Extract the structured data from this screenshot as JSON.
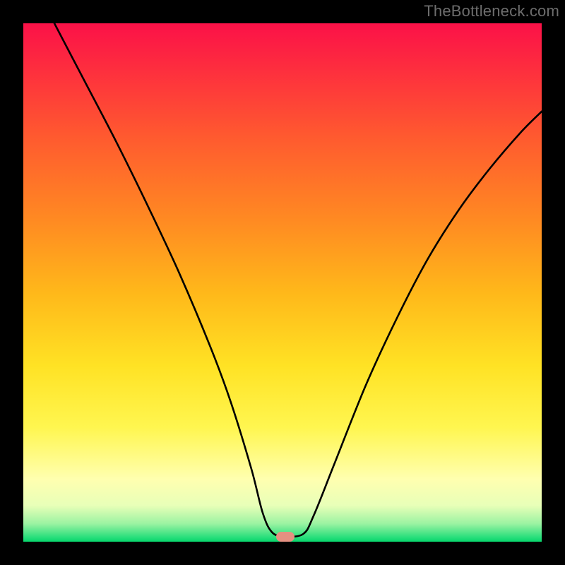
{
  "watermark": "TheBottleneck.com",
  "marker": {
    "x_frac": 0.505,
    "y_frac": 0.99
  },
  "chart_data": {
    "type": "line",
    "title": "",
    "xlabel": "",
    "ylabel": "",
    "xlim": [
      0,
      1
    ],
    "ylim": [
      0,
      1
    ],
    "series": [
      {
        "name": "bottleneck-curve",
        "x": [
          0.06,
          0.12,
          0.18,
          0.24,
          0.3,
          0.36,
          0.4,
          0.44,
          0.462,
          0.48,
          0.505,
          0.54,
          0.56,
          0.6,
          0.66,
          0.72,
          0.78,
          0.84,
          0.9,
          0.96,
          1.0
        ],
        "y": [
          1.0,
          0.885,
          0.77,
          0.648,
          0.52,
          0.378,
          0.27,
          0.14,
          0.055,
          0.018,
          0.01,
          0.015,
          0.05,
          0.15,
          0.3,
          0.43,
          0.545,
          0.64,
          0.72,
          0.79,
          0.83
        ]
      }
    ],
    "annotations": [
      {
        "type": "marker",
        "x": 0.505,
        "y": 0.01,
        "shape": "pill",
        "color": "#e59081"
      }
    ],
    "background": {
      "type": "vertical-gradient",
      "stops": [
        {
          "pos": 0.0,
          "color": "#fb1148"
        },
        {
          "pos": 0.22,
          "color": "#ff5a2f"
        },
        {
          "pos": 0.52,
          "color": "#ffb81a"
        },
        {
          "pos": 0.78,
          "color": "#fff650"
        },
        {
          "pos": 0.93,
          "color": "#e8ffb8"
        },
        {
          "pos": 1.0,
          "color": "#07d66c"
        }
      ]
    }
  }
}
